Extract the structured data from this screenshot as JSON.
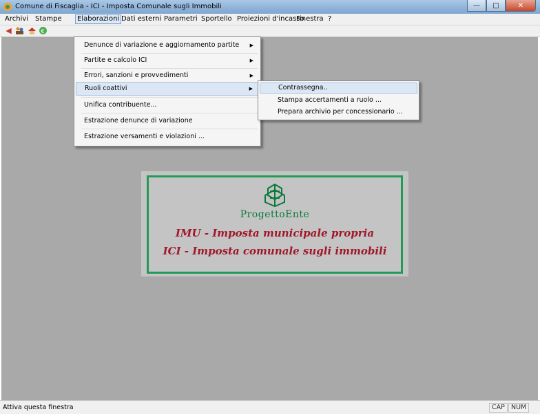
{
  "window": {
    "title": "Comune di Fiscaglia - ICI - Imposta Comunale sugli Immobili"
  },
  "menubar": {
    "items": [
      "Archivi",
      "Stampe",
      "Elaborazioni",
      "Dati esterni",
      "Parametri",
      "Sportello",
      "Proiezioni d'incasso",
      "Finestra",
      "?"
    ],
    "active": "Elaborazioni"
  },
  "elaborazioni_menu": {
    "items": [
      {
        "label": "Denunce di variazione e aggiornamento partite",
        "submenu": true
      },
      {
        "label": "Partite e calcolo ICI",
        "submenu": true
      },
      {
        "label": "Errori, sanzioni e provvedimenti",
        "submenu": true
      },
      {
        "label": "Ruoli coattivi",
        "submenu": true,
        "highlighted": true
      },
      {
        "label": "Unifica contribuente...",
        "submenu": false
      },
      {
        "label": "Estrazione denunce di variazione",
        "submenu": false
      },
      {
        "label": "Estrazione versamenti e violazioni ...",
        "submenu": false
      }
    ]
  },
  "ruoli_submenu": {
    "items": [
      {
        "label": "Contrassegna..",
        "highlighted": true
      },
      {
        "label": "Stampa accertamenti a ruolo ..."
      },
      {
        "label": "Prepara archivio per concessionario ..."
      }
    ]
  },
  "splash": {
    "brand": "ProgettoEnte",
    "line1": "IMU - Imposta municipale propria",
    "line2": "ICI - Imposta comunale sugli immobili"
  },
  "statusbar": {
    "text": "Attiva questa finestra",
    "cap": "CAP",
    "num": "NUM"
  },
  "colors": {
    "workspace": "#a9a9a9",
    "brand_green": "#1f9b55",
    "text_red": "#a0172a"
  }
}
